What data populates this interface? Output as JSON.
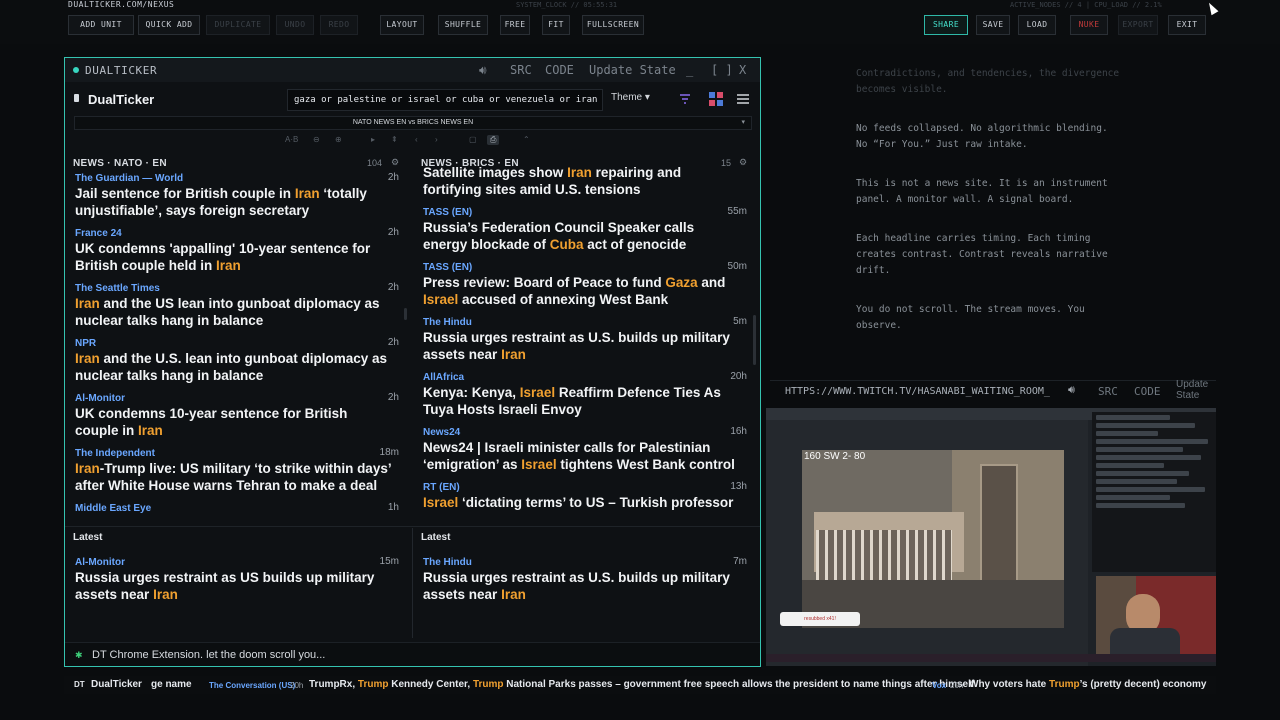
{
  "topbar": {
    "site_title": "DUALTICKER.COM/NEXUS",
    "system_clock": "SYSTEM_CLOCK // 05:55:31",
    "active_nodes": "ACTIVE_NODES // 4 | CPU_LOAD // 2.1%",
    "buttons": [
      "ADD UNIT",
      "QUICK ADD",
      "DUPLICATE",
      "UNDO",
      "REDO",
      "LAYOUT",
      "SHUFFLE",
      "FREE",
      "FIT",
      "FULLSCREEN",
      "SHARE",
      "SAVE",
      "LOAD",
      "NUKE",
      "EXPORT",
      "EXIT"
    ]
  },
  "window": {
    "title": "DUALTICKER",
    "controls": {
      "volume_icon": "speaker-icon",
      "src": "SRC",
      "code": "CODE",
      "update": "Update State",
      "min": "_",
      "max": "[ ]",
      "close": "X"
    }
  },
  "app": {
    "name": "DualTicker",
    "search_value": "gaza or palestine or israel or cuba or venezuela or iran",
    "theme_label": "Theme ▾",
    "feed_select": "NATO NEWS EN vs BRICS NEWS EN",
    "caret": "▾",
    "toolrow": [
      "A·B",
      "⊖",
      "⊕",
      "▸",
      "⇞",
      "‹",
      "›",
      "▢",
      "⎙",
      "⌃"
    ]
  },
  "left_column": {
    "title": "NEWS · NATO · EN",
    "count": "104",
    "items": [
      {
        "source": "The Guardian — World",
        "age": "2h",
        "parts": [
          "Jail sentence for British couple in ",
          "Iran",
          " ‘totally unjustifiable’, says foreign secretary"
        ]
      },
      {
        "source": "France 24",
        "age": "2h",
        "parts": [
          "UK condemns 'appalling' 10-year sentence for British couple held in ",
          "Iran",
          ""
        ]
      },
      {
        "source": "The Seattle Times",
        "age": "2h",
        "parts": [
          "",
          "Iran",
          " and the US lean into gunboat diplomacy as nuclear talks hang in balance"
        ]
      },
      {
        "source": "NPR",
        "age": "2h",
        "parts": [
          "",
          "Iran",
          " and the U.S. lean into gunboat diplomacy as nuclear talks hang in balance"
        ]
      },
      {
        "source": "Al-Monitor",
        "age": "2h",
        "parts": [
          "UK condemns 10-year sentence for British couple in ",
          "Iran",
          ""
        ]
      },
      {
        "source": "The Independent",
        "age": "18m",
        "parts": [
          "",
          "Iran",
          "-Trump live: US military ‘to strike within days’ after White House warns Tehran to make a deal"
        ]
      },
      {
        "source": "Middle East Eye",
        "age": "1h",
        "parts": [
          "",
          "",
          ""
        ]
      }
    ],
    "latest_label": "Latest",
    "latest": {
      "source": "Al-Monitor",
      "age": "15m",
      "parts": [
        "Russia urges restraint as US builds up military assets near ",
        "Iran",
        ""
      ]
    }
  },
  "right_column": {
    "title": "NEWS · BRICS · EN",
    "count": "15",
    "items": [
      {
        "source": "",
        "age": "",
        "parts": [
          "Satellite images show ",
          "Iran",
          " repairing and fortifying sites amid U.S. tensions"
        ]
      },
      {
        "source": "TASS (EN)",
        "age": "55m",
        "parts": [
          "Russia’s Federation Council Speaker calls energy blockade of ",
          "Cuba",
          " act of genocide"
        ]
      },
      {
        "source": "TASS (EN)",
        "age": "50m",
        "parts": [
          "Press review: Board of Peace to fund ",
          "Gaza",
          " and ",
          "Israel",
          " accused of annexing West Bank"
        ]
      },
      {
        "source": "The Hindu",
        "age": "5m",
        "parts": [
          "Russia urges restraint as U.S. builds up military assets near ",
          "Iran",
          ""
        ]
      },
      {
        "source": "AllAfrica",
        "age": "20h",
        "parts": [
          "Kenya: Kenya, ",
          "Israel",
          " Reaffirm Defence Ties As Tuya Hosts Israeli Envoy"
        ]
      },
      {
        "source": "News24",
        "age": "16h",
        "parts": [
          "News24 | Israeli minister calls for Palestinian ‘emigration’ as ",
          "Israel",
          " tightens West Bank control"
        ]
      },
      {
        "source": "RT (EN)",
        "age": "13h",
        "parts": [
          "",
          "Israel",
          " ‘dictating terms’ to US – Turkish professor"
        ]
      }
    ],
    "latest_label": "Latest",
    "latest": {
      "source": "The Hindu",
      "age": "7m",
      "parts": [
        "Russia urges restraint as U.S. builds up military assets near ",
        "Iran",
        ""
      ]
    }
  },
  "status": {
    "text": "DT Chrome Extension. let the doom scroll you...",
    "icon": "✱"
  },
  "info_panel": {
    "paragraphs": [
      "Contradictions, and tendencies, the divergence\nbecomes visible.",
      "No feeds collapsed. No algorithmic blending.\nNo “For You.” Just raw intake.",
      "This is not a news site. It is an instrument\npanel. A monitor wall. A signal board.",
      "Each headline carries timing. Each timing\ncreates contrast. Contrast reveals narrative\ndrift.",
      "You do not scroll. The stream moves. You\nobserve."
    ]
  },
  "twitch": {
    "url": "HTTPS://WWW.TWITCH.TV/HASANABI_WAITING_ROOM_",
    "src": "SRC",
    "code": "CODE",
    "update": "Update State",
    "cctv_label": "160 SW 2- 80",
    "popup": "resubbed x41!"
  },
  "bottom_ticker": {
    "logo": "DT",
    "name": "DualTicker",
    "fragment": "ge name",
    "items": [
      {
        "source": "The Conversation (US)",
        "age": "20h",
        "parts": [
          "TrumpRx, ",
          "Trump",
          " Kennedy Center, ",
          "Trump",
          " National Parks passes – government free speech allows the president to name things after himself"
        ]
      },
      {
        "source": "Vox",
        "age": "20h",
        "parts": [
          "Why voters hate ",
          "Trump",
          "’s (pretty decent) economy"
        ]
      }
    ]
  },
  "colors": {
    "accent": "#35c3b0",
    "keyword": "#f0a030",
    "source": "#6aa7ff",
    "nuke": "#c03a3a"
  }
}
